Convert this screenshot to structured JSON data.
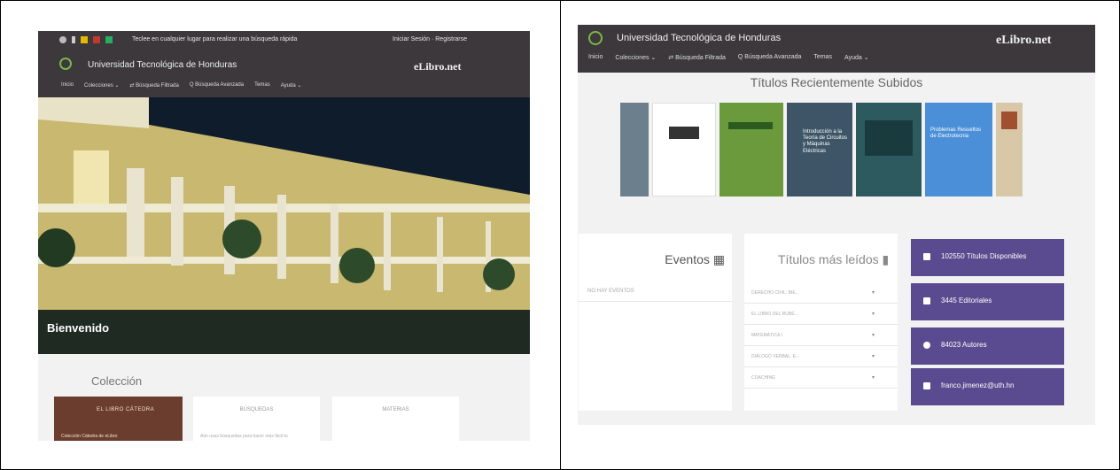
{
  "left": {
    "topbar": {
      "search_text": "Teclee en cualquier lugar para realizar una búsqueda rápida",
      "login_text": "Iniciar Sesión · Registrarse"
    },
    "header": {
      "university": "Universidad Tecnológica de Honduras",
      "brand": "eLibro.net",
      "nav": [
        "Inicio",
        "Colecciones ⌄",
        "⇄ Búsqueda Filtrada",
        "Q Búsqueda Avanzada",
        "Temas",
        "Ayuda ⌄"
      ]
    },
    "hero": {
      "welcome": "Bienvenido"
    },
    "coleccion_title": "Colección",
    "cards": {
      "book_title": "EL LIBRO CÁTEDRA",
      "book_sub": "Colección Cátedra de eLibro",
      "busquedas_title": "BÚSQUEDAS",
      "busquedas_body": "Aún usas búsquedas para hacer más fácil tu",
      "materias_title": "MATERIAS"
    }
  },
  "right": {
    "header": {
      "university": "Universidad Tecnológica de Honduras",
      "brand": "eLibro.net",
      "nav": [
        "Inicio",
        "Colecciones ⌄",
        "⇄ Búsqueda Filtrada",
        "Q Búsqueda Avanzada",
        "Temas",
        "Ayuda ⌄"
      ]
    },
    "recent_title": "Títulos Recientemente Subidos",
    "books": [
      {
        "title": "",
        "color": "#6c7f8c"
      },
      {
        "title": "",
        "color": "#ffffff"
      },
      {
        "title": "",
        "color": "#6b9a3c"
      },
      {
        "title": "Introducción a la Teoría de Circuitos y Máquinas Eléctricas",
        "color": "#3d5566"
      },
      {
        "title": "",
        "color": "#2d5a5e"
      },
      {
        "title": "Problemas Resueltos de Electrotecnia",
        "color": "#4a8fd8"
      },
      {
        "title": "",
        "color": "#d8c8a8"
      }
    ],
    "eventos": {
      "title": "Eventos",
      "empty": "NO HAY EVENTOS"
    },
    "top_titles": {
      "title": "Títulos más leídos",
      "rows": [
        "DERECHO CIVIL: BIE...",
        "EL LIBRO DEL RUBÉ...",
        "MATEMÁTICA I",
        "DIÁLOGO VERBAL: E...",
        "COACHING"
      ]
    },
    "stats": [
      "102550 Títulos Disponibles",
      "3445 Editoriales",
      "84023 Autores",
      "franco.jimenez@uth.hn"
    ]
  }
}
